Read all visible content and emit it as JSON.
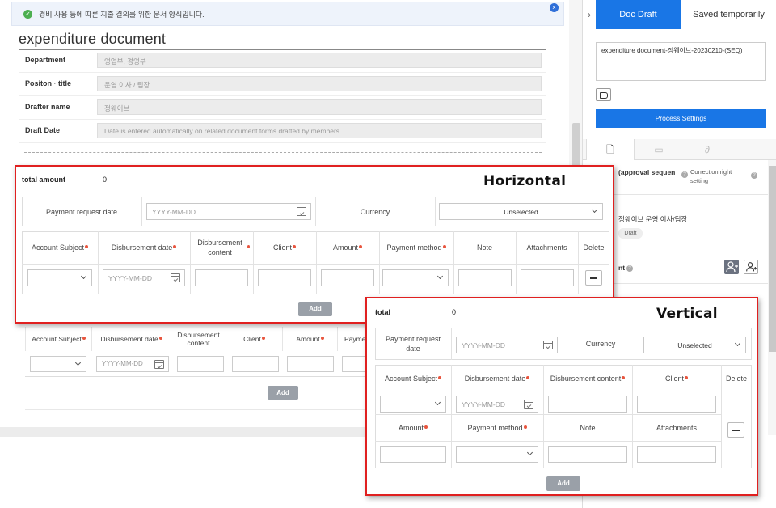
{
  "notice": {
    "text": "경비 사용 등에 따른 지출 결의를 위한 문서 양식입니다."
  },
  "document": {
    "title": "expenditure document",
    "fields": [
      {
        "label": "Department",
        "value": "영업부, 경영부"
      },
      {
        "label": "Positon · title",
        "value": "운영 이사 / 팀장"
      },
      {
        "label": "Drafter name",
        "value": "정웨이브"
      },
      {
        "label": "Draft Date",
        "value": "Date is entered automatically on related document forms drafted by members."
      }
    ],
    "bg_table": {
      "headers": [
        "Account Subject",
        "Disbursement date",
        "Disbursement content",
        "Client",
        "Amount",
        "Payme"
      ],
      "date_placeholder": "YYYY-MM-DD",
      "add_label": "Add"
    }
  },
  "right_panel": {
    "tabs": {
      "doc_draft": "Doc Draft",
      "saved": "Saved temporarily"
    },
    "doc_name": "expenditure document-정웨이브-20230210-(SEQ)",
    "process_settings": "Process Settings",
    "approval_header": "(approval sequen",
    "correction_right": "Correction right setting",
    "approver": "정웨이브 운영 이사/팀장",
    "draft_badge": "Draft",
    "section_label": "nt"
  },
  "horizontal_card": {
    "label": "Horizontal",
    "total_label": "total amount",
    "total_value": "0",
    "payment_request_date": "Payment request date",
    "date_placeholder": "YYYY-MM-DD",
    "currency_label": "Currency",
    "currency_value": "Unselected",
    "headers": [
      "Account Subject",
      "Disbursement date",
      "Disbursement content",
      "Client",
      "Amount",
      "Payment method",
      "Note",
      "Attachments",
      "Delete"
    ],
    "add_label": "Add"
  },
  "vertical_card": {
    "label": "Vertical",
    "total_label": "total",
    "total_value": "0",
    "payment_request_date": "Payment request date",
    "date_placeholder": "YYYY-MM-DD",
    "currency_label": "Currency",
    "currency_value": "Unselected",
    "headers_row1": [
      "Account Subject",
      "Disbursement date",
      "Disbursement content",
      "Client"
    ],
    "headers_row2": [
      "Amount",
      "Payment method",
      "Note",
      "Attachments"
    ],
    "delete_label": "Delete",
    "add_label": "Add"
  },
  "colors": {
    "accent": "#1976e6",
    "highlight_border": "#e02020",
    "required_dot": "#e8553e"
  }
}
